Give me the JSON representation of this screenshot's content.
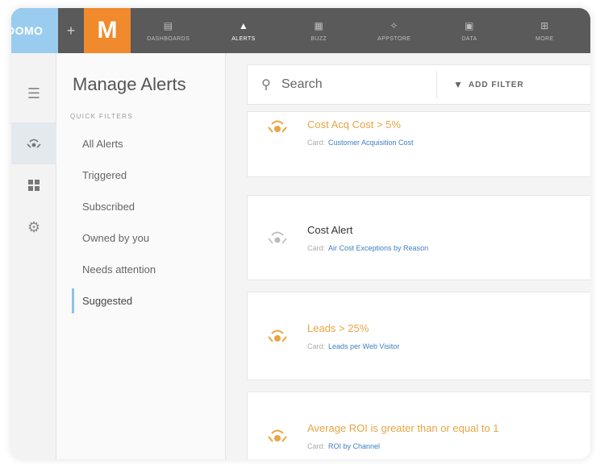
{
  "topbar": {
    "brand": "DOMO",
    "plus": "+",
    "logo_letter": "M",
    "nav": [
      {
        "label": "DASHBOARDS",
        "icon": "dashboards-icon",
        "active": false
      },
      {
        "label": "ALERTS",
        "icon": "alerts-icon",
        "active": true
      },
      {
        "label": "BUZZ",
        "icon": "buzz-icon",
        "active": false
      },
      {
        "label": "APPSTORE",
        "icon": "appstore-icon",
        "active": false
      },
      {
        "label": "DATA",
        "icon": "data-icon",
        "active": false
      },
      {
        "label": "MORE",
        "icon": "more-icon",
        "active": false
      }
    ]
  },
  "sidebar": {
    "title": "Manage Alerts",
    "quick_filters_label": "QUICK FILTERS",
    "items": [
      {
        "label": "All Alerts"
      },
      {
        "label": "Triggered"
      },
      {
        "label": "Subscribed"
      },
      {
        "label": "Owned by you"
      },
      {
        "label": "Needs attention"
      },
      {
        "label": "Suggested",
        "active": true
      }
    ]
  },
  "search": {
    "placeholder": "Search",
    "add_filter_label": "ADD FILTER"
  },
  "cards": [
    {
      "title": "Cost Acq Cost > 5%",
      "card_label": "Card:",
      "card_name": "Customer Acquisition Cost",
      "triggered": true
    },
    {
      "title": "Cost Alert",
      "card_label": "Card:",
      "card_name": "Air Cost Exceptions by Reason",
      "triggered": false
    },
    {
      "title": "Leads > 25%",
      "card_label": "Card:",
      "card_name": "Leads per Web Visitor",
      "triggered": true
    },
    {
      "title": "Average ROI is greater than or equal to 1",
      "card_label": "Card:",
      "card_name": "ROI by Channel",
      "triggered": true
    }
  ],
  "colors": {
    "topbar": "#5a5a5a",
    "brand": "#99ccee",
    "logo": "#f08a2c",
    "alert_orange": "#e8a544",
    "link_blue": "#3f7fbf",
    "accent": "#8cc3e6"
  }
}
